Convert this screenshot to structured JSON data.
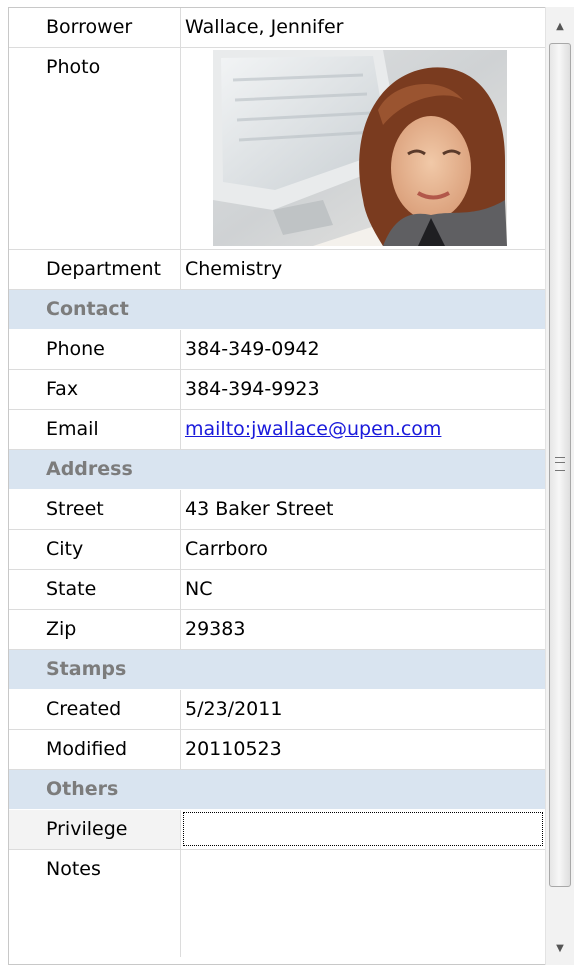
{
  "rows": [
    {
      "label": "Borrower",
      "value": "Wallace, Jennifer"
    },
    {
      "label": "Photo"
    },
    {
      "label": "Department",
      "value": "Chemistry"
    }
  ],
  "categories": {
    "contact": "Contact",
    "address": "Address",
    "stamps": "Stamps",
    "others": "Others"
  },
  "contact": {
    "phone_label": "Phone",
    "phone": "384-349-0942",
    "fax_label": "Fax",
    "fax": "384-394-9923",
    "email_label": "Email",
    "email": "mailto:jwallace@upen.com"
  },
  "address": {
    "street_label": "Street",
    "street": "43 Baker Street",
    "city_label": "City",
    "city": "Carrboro",
    "state_label": "State",
    "state": "NC",
    "zip_label": "Zip",
    "zip": "29383"
  },
  "stamps": {
    "created_label": "Created",
    "created": "5/23/2011",
    "modified_label": "Modified",
    "modified": "20110523"
  },
  "others": {
    "privilege_label": "Privilege",
    "privilege": "",
    "notes_label": "Notes",
    "notes": ""
  },
  "icons": {
    "scroll_up": "scroll-up-arrow-icon",
    "scroll_down": "scroll-down-arrow-icon",
    "grip": "scroll-grip-icon"
  },
  "colors": {
    "category_bg": "#d9e4f0",
    "category_text": "#7c7c7c",
    "link": "#1a1adb"
  }
}
